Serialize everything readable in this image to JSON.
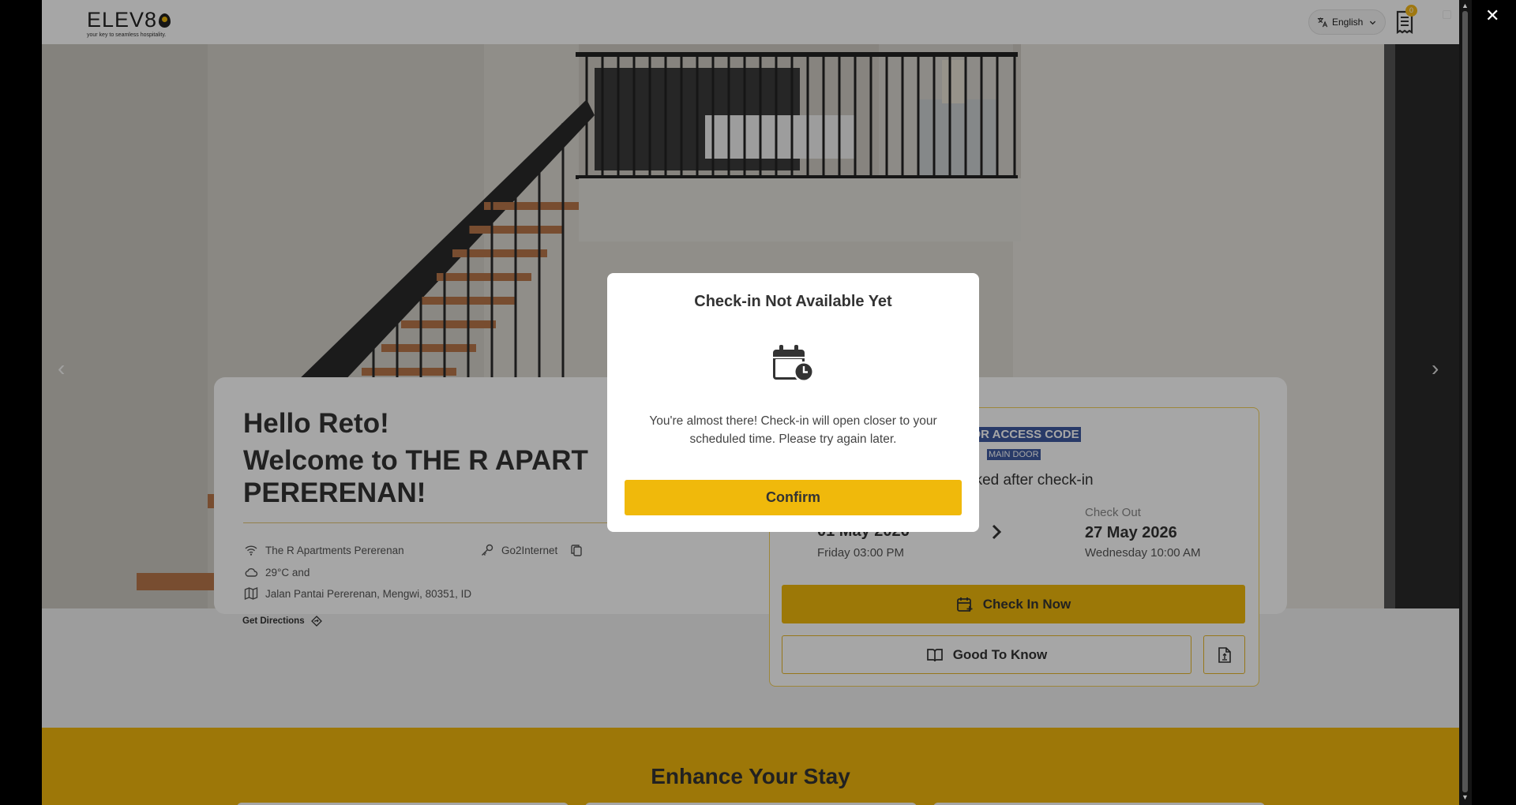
{
  "header": {
    "logo_text": "ELEV8",
    "tagline": "your key to seamless hospitality.",
    "language": "English",
    "cart_count": "0"
  },
  "greeting": {
    "hello": "Hello Reto!",
    "welcome_line1": "Welcome to THE R APART",
    "welcome_line2": "PERERENAN!",
    "property": "The R Apartments Pererenan",
    "wifi": "Go2Internet",
    "weather": "29°C and",
    "address": "Jalan Pantai Pererenan, Mengwi, 80351, ID",
    "directions": "Get Directions"
  },
  "booking": {
    "door_code_label": "DOOR ACCESS CODE",
    "door_label": "MAIN DOOR",
    "unlock_text": "Unlocked after check-in",
    "checkin_date": "01 May 2026",
    "checkin_time": "Friday 03:00 PM",
    "checkout_label": "Check Out",
    "checkout_date": "27 May 2026",
    "checkout_time": "Wednesday 10:00 AM",
    "checkin_button": "Check In Now",
    "good_to_know_button": "Good To Know"
  },
  "enhance": {
    "title": "Enhance Your Stay"
  },
  "modal": {
    "title": "Check-in Not Available Yet",
    "message": "You're almost there! Check-in will open closer to your scheduled time. Please try again later.",
    "confirm": "Confirm"
  },
  "icons": {
    "language": "translate-icon",
    "cart": "receipt-icon",
    "wifi": "wifi-icon",
    "key": "key-icon",
    "copy": "copy-icon",
    "weather": "cloud-icon",
    "map": "map-icon",
    "directions": "directions-icon",
    "calendar": "calendar-clock-icon",
    "checkin": "calendar-plus-icon",
    "book": "book-icon",
    "document": "document-icon"
  },
  "colors": {
    "accent": "#f0b90b",
    "selection": "#3e5aa0"
  }
}
